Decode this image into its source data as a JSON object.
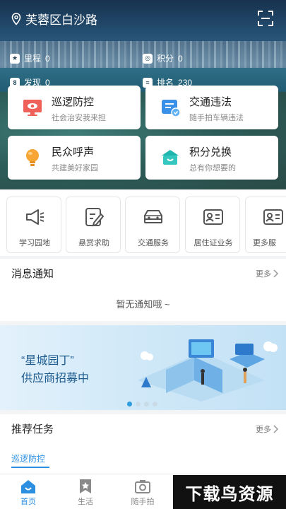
{
  "header": {
    "location": "芙蓉区白沙路"
  },
  "stats": [
    {
      "label": "里程",
      "value": "0"
    },
    {
      "label": "积分",
      "value": "0"
    },
    {
      "label": "发现",
      "value": "0"
    },
    {
      "label": "排名",
      "value": "230"
    }
  ],
  "cards": [
    {
      "title": "巡逻防控",
      "subtitle": "社会治安我来担"
    },
    {
      "title": "交通违法",
      "subtitle": "随手拍车辆违法"
    },
    {
      "title": "民众呼声",
      "subtitle": "共建美好家园"
    },
    {
      "title": "积分兑换",
      "subtitle": "总有你想要的"
    }
  ],
  "services": [
    {
      "label": "学习园地"
    },
    {
      "label": "悬赏求助"
    },
    {
      "label": "交通服务"
    },
    {
      "label": "居住证业务"
    },
    {
      "label": "更多服"
    }
  ],
  "notice": {
    "title": "消息通知",
    "more": "更多",
    "empty": "暂无通知哦 ~"
  },
  "banner": {
    "line1": "“星城园丁”",
    "line2": "供应商招募中"
  },
  "recommend": {
    "title": "推荐任务",
    "more": "更多",
    "tab": "巡逻防控"
  },
  "tabbar": [
    {
      "label": "首页"
    },
    {
      "label": "生活"
    },
    {
      "label": "随手拍"
    }
  ],
  "watermark": "下载鸟资源",
  "colors": {
    "accent": "#2d8fe0",
    "brand_dark": "#1e5b8e"
  }
}
